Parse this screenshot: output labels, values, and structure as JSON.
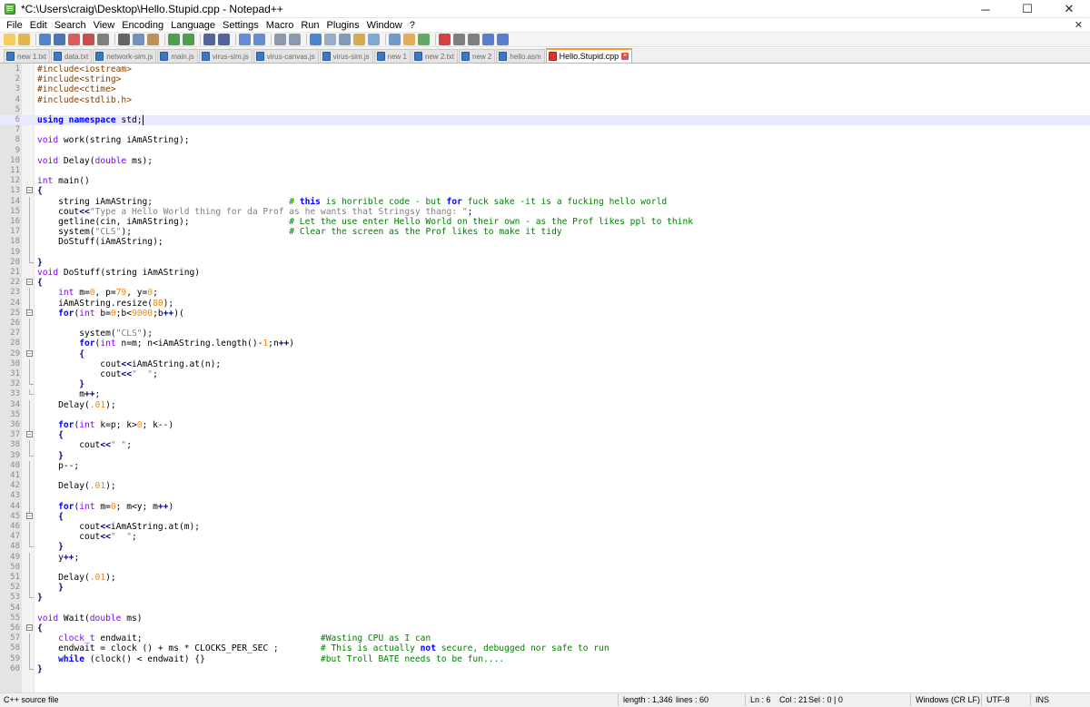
{
  "window": {
    "title": "*C:\\Users\\craig\\Desktop\\Hello.Stupid.cpp - Notepad++",
    "minimize": "─",
    "maximize": "☐",
    "close": "✕"
  },
  "menu": [
    "File",
    "Edit",
    "Search",
    "View",
    "Encoding",
    "Language",
    "Settings",
    "Macro",
    "Run",
    "Plugins",
    "Window",
    "?"
  ],
  "menu_close": "✕",
  "toolbar_icons": [
    "new-file-icon",
    "open-file-icon",
    "save-icon",
    "save-all-icon",
    "close-icon",
    "close-all-icon",
    "print-icon",
    "cut-icon",
    "copy-icon",
    "paste-icon",
    "undo-icon",
    "redo-icon",
    "find-icon",
    "replace-icon",
    "zoom-in-icon",
    "zoom-out-icon",
    "sync-vertical-icon",
    "sync-horizontal-icon",
    "word-wrap-icon",
    "show-all-chars-icon",
    "indent-guide-icon",
    "user-lang-icon",
    "doc-map-icon",
    "function-list-icon",
    "folder-icon",
    "monitor-icon",
    "record-macro-icon",
    "stop-record-icon",
    "play-macro-icon",
    "play-multiple-icon",
    "save-macro-icon"
  ],
  "tabs": [
    {
      "label": "new 1.txt",
      "active": false
    },
    {
      "label": "data.txt",
      "active": false
    },
    {
      "label": "network-sim.js",
      "active": false
    },
    {
      "label": "main.js",
      "active": false
    },
    {
      "label": "virus-sim.js",
      "active": false
    },
    {
      "label": "virus-canvas.js",
      "active": false
    },
    {
      "label": "virus-sim.js",
      "active": false
    },
    {
      "label": "new 1",
      "active": false
    },
    {
      "label": "new 2.txt",
      "active": false
    },
    {
      "label": "new 2",
      "active": false
    },
    {
      "label": "hello.asm",
      "active": false
    },
    {
      "label": "Hello.Stupid.cpp",
      "active": true
    }
  ],
  "code_lines": [
    [
      [
        "p",
        "#include<iostream>"
      ]
    ],
    [
      [
        "p",
        "#include<string>"
      ]
    ],
    [
      [
        "p",
        "#include<ctime>"
      ]
    ],
    [
      [
        "p",
        "#include<stdlib.h>"
      ]
    ],
    [],
    [
      [
        "k",
        "using"
      ],
      [
        "m",
        " "
      ],
      [
        "k",
        "namespace"
      ],
      [
        "m",
        " std;"
      ]
    ],
    [],
    [
      [
        "t",
        "void"
      ],
      [
        "m",
        " work(string iAmAString);"
      ]
    ],
    [],
    [
      [
        "t",
        "void"
      ],
      [
        "m",
        " Delay("
      ],
      [
        "t",
        "double"
      ],
      [
        "m",
        " ms);"
      ]
    ],
    [],
    [
      [
        "t",
        "int"
      ],
      [
        "m",
        " main()"
      ]
    ],
    [
      [
        "o",
        "{"
      ]
    ],
    [
      [
        "m",
        "    string iAmAString;                          "
      ],
      [
        "c",
        "# "
      ],
      [
        "k",
        "this"
      ],
      [
        "c",
        " is horrible code - but "
      ],
      [
        "k",
        "for"
      ],
      [
        "c",
        " fuck sake -it is a fucking hello world"
      ]
    ],
    [
      [
        "m",
        "    cout"
      ],
      [
        "o",
        "<<"
      ],
      [
        "s",
        "\"Type a Hello World thing for da Prof as he wants that Stringsy thang: \""
      ],
      [
        "m",
        ";"
      ]
    ],
    [
      [
        "m",
        "    getline(cin, iAmAString);                   "
      ],
      [
        "c",
        "# Let the use enter Hello World on their own - as the Prof likes ppl to think"
      ]
    ],
    [
      [
        "m",
        "    system("
      ],
      [
        "s",
        "\"CLS\""
      ],
      [
        "m",
        ");                              "
      ],
      [
        "c",
        "# Clear the screen as the Prof likes to make it tidy"
      ]
    ],
    [
      [
        "m",
        "    DoStuff(iAmAString);"
      ]
    ],
    [],
    [
      [
        "o",
        "}"
      ]
    ],
    [
      [
        "t",
        "void"
      ],
      [
        "m",
        " DoStuff(string iAmAString)"
      ]
    ],
    [
      [
        "o",
        "{"
      ]
    ],
    [
      [
        "m",
        "    "
      ],
      [
        "t",
        "int"
      ],
      [
        "m",
        " m="
      ],
      [
        "n",
        "0"
      ],
      [
        "m",
        ", p="
      ],
      [
        "n",
        "79"
      ],
      [
        "m",
        ", y="
      ],
      [
        "n",
        "0"
      ],
      [
        "m",
        ";"
      ]
    ],
    [
      [
        "m",
        "    iAmAString.resize("
      ],
      [
        "n",
        "80"
      ],
      [
        "m",
        ");"
      ]
    ],
    [
      [
        "m",
        "    "
      ],
      [
        "k",
        "for"
      ],
      [
        "m",
        "("
      ],
      [
        "t",
        "int"
      ],
      [
        "m",
        " b="
      ],
      [
        "n",
        "0"
      ],
      [
        "m",
        ";b<"
      ],
      [
        "n",
        "9000"
      ],
      [
        "m",
        ";b"
      ],
      [
        "o",
        "++"
      ],
      [
        "m",
        ")("
      ]
    ],
    [],
    [
      [
        "m",
        "        system("
      ],
      [
        "s",
        "\"CLS\""
      ],
      [
        "m",
        ");"
      ]
    ],
    [
      [
        "m",
        "        "
      ],
      [
        "k",
        "for"
      ],
      [
        "m",
        "("
      ],
      [
        "t",
        "int"
      ],
      [
        "m",
        " n=m; n<iAmAString.length()-"
      ],
      [
        "n",
        "1"
      ],
      [
        "m",
        ";n"
      ],
      [
        "o",
        "++"
      ],
      [
        "m",
        ")"
      ]
    ],
    [
      [
        "m",
        "        "
      ],
      [
        "o",
        "{"
      ]
    ],
    [
      [
        "m",
        "            cout"
      ],
      [
        "o",
        "<<"
      ],
      [
        "m",
        "iAmAString.at(n);"
      ]
    ],
    [
      [
        "m",
        "            cout"
      ],
      [
        "o",
        "<<"
      ],
      [
        "s",
        "\"  \""
      ],
      [
        "m",
        ";"
      ]
    ],
    [
      [
        "m",
        "        "
      ],
      [
        "o",
        "}"
      ]
    ],
    [
      [
        "m",
        "        m"
      ],
      [
        "o",
        "++"
      ],
      [
        "m",
        ";"
      ]
    ],
    [
      [
        "m",
        "    Delay("
      ],
      [
        "n",
        ".01"
      ],
      [
        "m",
        ");"
      ]
    ],
    [],
    [
      [
        "m",
        "    "
      ],
      [
        "k",
        "for"
      ],
      [
        "m",
        "("
      ],
      [
        "t",
        "int"
      ],
      [
        "m",
        " k=p; k>"
      ],
      [
        "n",
        "0"
      ],
      [
        "m",
        "; k--)"
      ]
    ],
    [
      [
        "m",
        "    "
      ],
      [
        "o",
        "{"
      ]
    ],
    [
      [
        "m",
        "        cout"
      ],
      [
        "o",
        "<<"
      ],
      [
        "s",
        "\" \""
      ],
      [
        "m",
        ";"
      ]
    ],
    [
      [
        "m",
        "    "
      ],
      [
        "o",
        "}"
      ]
    ],
    [
      [
        "m",
        "    p--;"
      ]
    ],
    [],
    [
      [
        "m",
        "    Delay("
      ],
      [
        "n",
        ".01"
      ],
      [
        "m",
        ");"
      ]
    ],
    [],
    [
      [
        "m",
        "    "
      ],
      [
        "k",
        "for"
      ],
      [
        "m",
        "("
      ],
      [
        "t",
        "int"
      ],
      [
        "m",
        " m="
      ],
      [
        "n",
        "0"
      ],
      [
        "m",
        "; m<y; m"
      ],
      [
        "o",
        "++"
      ],
      [
        "m",
        ")"
      ]
    ],
    [
      [
        "m",
        "    "
      ],
      [
        "o",
        "{"
      ]
    ],
    [
      [
        "m",
        "        cout"
      ],
      [
        "o",
        "<<"
      ],
      [
        "m",
        "iAmAString.at(m);"
      ]
    ],
    [
      [
        "m",
        "        cout"
      ],
      [
        "o",
        "<<"
      ],
      [
        "s",
        "\"  \""
      ],
      [
        "m",
        ";"
      ]
    ],
    [
      [
        "m",
        "    "
      ],
      [
        "o",
        "}"
      ]
    ],
    [
      [
        "m",
        "    y"
      ],
      [
        "o",
        "++"
      ],
      [
        "m",
        ";"
      ]
    ],
    [],
    [
      [
        "m",
        "    Delay("
      ],
      [
        "n",
        ".01"
      ],
      [
        "m",
        ");"
      ]
    ],
    [
      [
        "m",
        "    "
      ],
      [
        "o",
        "}"
      ]
    ],
    [
      [
        "o",
        "}"
      ]
    ],
    [],
    [
      [
        "t",
        "void"
      ],
      [
        "m",
        " Wait("
      ],
      [
        "t",
        "double"
      ],
      [
        "m",
        " ms)"
      ]
    ],
    [
      [
        "o",
        "{"
      ]
    ],
    [
      [
        "m",
        "    "
      ],
      [
        "t",
        "clock_t"
      ],
      [
        "m",
        " endwait;                                  "
      ],
      [
        "c",
        "#Wasting CPU as I can"
      ]
    ],
    [
      [
        "m",
        "    endwait = clock () + ms * CLOCKS_PER_SEC ;        "
      ],
      [
        "c",
        "# This is actually "
      ],
      [
        "k",
        "not"
      ],
      [
        "c",
        " secure, debugged nor safe to run"
      ]
    ],
    [
      [
        "m",
        "    "
      ],
      [
        "k",
        "while"
      ],
      [
        "m",
        " (clock() < endwait) {}                      "
      ],
      [
        "c",
        "#but Troll BATE needs to be fun...."
      ]
    ],
    [
      [
        "o",
        "}"
      ]
    ]
  ],
  "current_line": 6,
  "fold_markers": {
    "13": "open",
    "20": "end",
    "22": "open",
    "25": "open",
    "29": "open",
    "32": "end",
    "33": "end",
    "37": "open",
    "39": "end",
    "45": "open",
    "48": "end",
    "53": "end",
    "56": "open",
    "60": "end"
  },
  "status": {
    "file_type": "C++ source file",
    "length": "length : 1,346",
    "lines": "lines : 60",
    "ln": "Ln : 6",
    "col": "Col : 21",
    "sel": "Sel : 0 | 0",
    "eol": "Windows (CR LF)",
    "encoding": "UTF-8",
    "mode": "INS"
  }
}
